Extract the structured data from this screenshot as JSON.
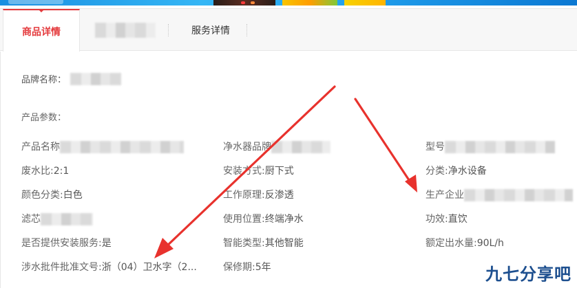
{
  "tabs": {
    "product_details": "商品详情",
    "service_details": "服务详情"
  },
  "brand": {
    "label": "品牌名称："
  },
  "params": {
    "section_title": "产品参数：",
    "items": [
      {
        "label": "产品名称",
        "value": ""
      },
      {
        "label": "净水器品牌",
        "value": ""
      },
      {
        "label": "型号",
        "value": ""
      },
      {
        "label": "废水比: ",
        "value": "2:1"
      },
      {
        "label": "安装方式: ",
        "value": "厨下式"
      },
      {
        "label": "分类: ",
        "value": "净水设备"
      },
      {
        "label": "颜色分类: ",
        "value": "白色"
      },
      {
        "label": "工作原理: ",
        "value": "反渗透"
      },
      {
        "label": "生产企业",
        "value": ""
      },
      {
        "label": "滤芯",
        "value": ""
      },
      {
        "label": "使用位置: ",
        "value": "终端净水"
      },
      {
        "label": "功效: ",
        "value": "直饮"
      },
      {
        "label": "是否提供安装服务: ",
        "value": "是"
      },
      {
        "label": "智能类型: ",
        "value": "其他智能"
      },
      {
        "label": "额定出水量: ",
        "value": "90L/h"
      },
      {
        "label": "涉水批件批准文号: ",
        "value": "浙（04）卫水字（2..."
      },
      {
        "label": "保修期: ",
        "value": "5年"
      }
    ]
  },
  "watermark": {
    "text": "九七分享吧"
  },
  "colors": {
    "accent": "#e4393c",
    "arrow": "#e8322d",
    "watermark": "#1d4f8f"
  }
}
